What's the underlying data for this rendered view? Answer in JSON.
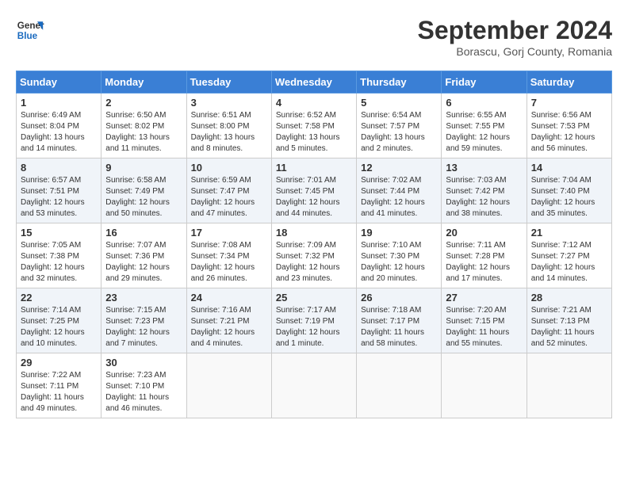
{
  "header": {
    "logo_line1": "General",
    "logo_line2": "Blue",
    "month": "September 2024",
    "location": "Borascu, Gorj County, Romania"
  },
  "weekdays": [
    "Sunday",
    "Monday",
    "Tuesday",
    "Wednesday",
    "Thursday",
    "Friday",
    "Saturday"
  ],
  "weeks": [
    [
      {
        "day": "1",
        "info": "Sunrise: 6:49 AM\nSunset: 8:04 PM\nDaylight: 13 hours\nand 14 minutes."
      },
      {
        "day": "2",
        "info": "Sunrise: 6:50 AM\nSunset: 8:02 PM\nDaylight: 13 hours\nand 11 minutes."
      },
      {
        "day": "3",
        "info": "Sunrise: 6:51 AM\nSunset: 8:00 PM\nDaylight: 13 hours\nand 8 minutes."
      },
      {
        "day": "4",
        "info": "Sunrise: 6:52 AM\nSunset: 7:58 PM\nDaylight: 13 hours\nand 5 minutes."
      },
      {
        "day": "5",
        "info": "Sunrise: 6:54 AM\nSunset: 7:57 PM\nDaylight: 13 hours\nand 2 minutes."
      },
      {
        "day": "6",
        "info": "Sunrise: 6:55 AM\nSunset: 7:55 PM\nDaylight: 12 hours\nand 59 minutes."
      },
      {
        "day": "7",
        "info": "Sunrise: 6:56 AM\nSunset: 7:53 PM\nDaylight: 12 hours\nand 56 minutes."
      }
    ],
    [
      {
        "day": "8",
        "info": "Sunrise: 6:57 AM\nSunset: 7:51 PM\nDaylight: 12 hours\nand 53 minutes."
      },
      {
        "day": "9",
        "info": "Sunrise: 6:58 AM\nSunset: 7:49 PM\nDaylight: 12 hours\nand 50 minutes."
      },
      {
        "day": "10",
        "info": "Sunrise: 6:59 AM\nSunset: 7:47 PM\nDaylight: 12 hours\nand 47 minutes."
      },
      {
        "day": "11",
        "info": "Sunrise: 7:01 AM\nSunset: 7:45 PM\nDaylight: 12 hours\nand 44 minutes."
      },
      {
        "day": "12",
        "info": "Sunrise: 7:02 AM\nSunset: 7:44 PM\nDaylight: 12 hours\nand 41 minutes."
      },
      {
        "day": "13",
        "info": "Sunrise: 7:03 AM\nSunset: 7:42 PM\nDaylight: 12 hours\nand 38 minutes."
      },
      {
        "day": "14",
        "info": "Sunrise: 7:04 AM\nSunset: 7:40 PM\nDaylight: 12 hours\nand 35 minutes."
      }
    ],
    [
      {
        "day": "15",
        "info": "Sunrise: 7:05 AM\nSunset: 7:38 PM\nDaylight: 12 hours\nand 32 minutes."
      },
      {
        "day": "16",
        "info": "Sunrise: 7:07 AM\nSunset: 7:36 PM\nDaylight: 12 hours\nand 29 minutes."
      },
      {
        "day": "17",
        "info": "Sunrise: 7:08 AM\nSunset: 7:34 PM\nDaylight: 12 hours\nand 26 minutes."
      },
      {
        "day": "18",
        "info": "Sunrise: 7:09 AM\nSunset: 7:32 PM\nDaylight: 12 hours\nand 23 minutes."
      },
      {
        "day": "19",
        "info": "Sunrise: 7:10 AM\nSunset: 7:30 PM\nDaylight: 12 hours\nand 20 minutes."
      },
      {
        "day": "20",
        "info": "Sunrise: 7:11 AM\nSunset: 7:28 PM\nDaylight: 12 hours\nand 17 minutes."
      },
      {
        "day": "21",
        "info": "Sunrise: 7:12 AM\nSunset: 7:27 PM\nDaylight: 12 hours\nand 14 minutes."
      }
    ],
    [
      {
        "day": "22",
        "info": "Sunrise: 7:14 AM\nSunset: 7:25 PM\nDaylight: 12 hours\nand 10 minutes."
      },
      {
        "day": "23",
        "info": "Sunrise: 7:15 AM\nSunset: 7:23 PM\nDaylight: 12 hours\nand 7 minutes."
      },
      {
        "day": "24",
        "info": "Sunrise: 7:16 AM\nSunset: 7:21 PM\nDaylight: 12 hours\nand 4 minutes."
      },
      {
        "day": "25",
        "info": "Sunrise: 7:17 AM\nSunset: 7:19 PM\nDaylight: 12 hours\nand 1 minute."
      },
      {
        "day": "26",
        "info": "Sunrise: 7:18 AM\nSunset: 7:17 PM\nDaylight: 11 hours\nand 58 minutes."
      },
      {
        "day": "27",
        "info": "Sunrise: 7:20 AM\nSunset: 7:15 PM\nDaylight: 11 hours\nand 55 minutes."
      },
      {
        "day": "28",
        "info": "Sunrise: 7:21 AM\nSunset: 7:13 PM\nDaylight: 11 hours\nand 52 minutes."
      }
    ],
    [
      {
        "day": "29",
        "info": "Sunrise: 7:22 AM\nSunset: 7:11 PM\nDaylight: 11 hours\nand 49 minutes."
      },
      {
        "day": "30",
        "info": "Sunrise: 7:23 AM\nSunset: 7:10 PM\nDaylight: 11 hours\nand 46 minutes."
      },
      {
        "day": "",
        "info": ""
      },
      {
        "day": "",
        "info": ""
      },
      {
        "day": "",
        "info": ""
      },
      {
        "day": "",
        "info": ""
      },
      {
        "day": "",
        "info": ""
      }
    ]
  ]
}
